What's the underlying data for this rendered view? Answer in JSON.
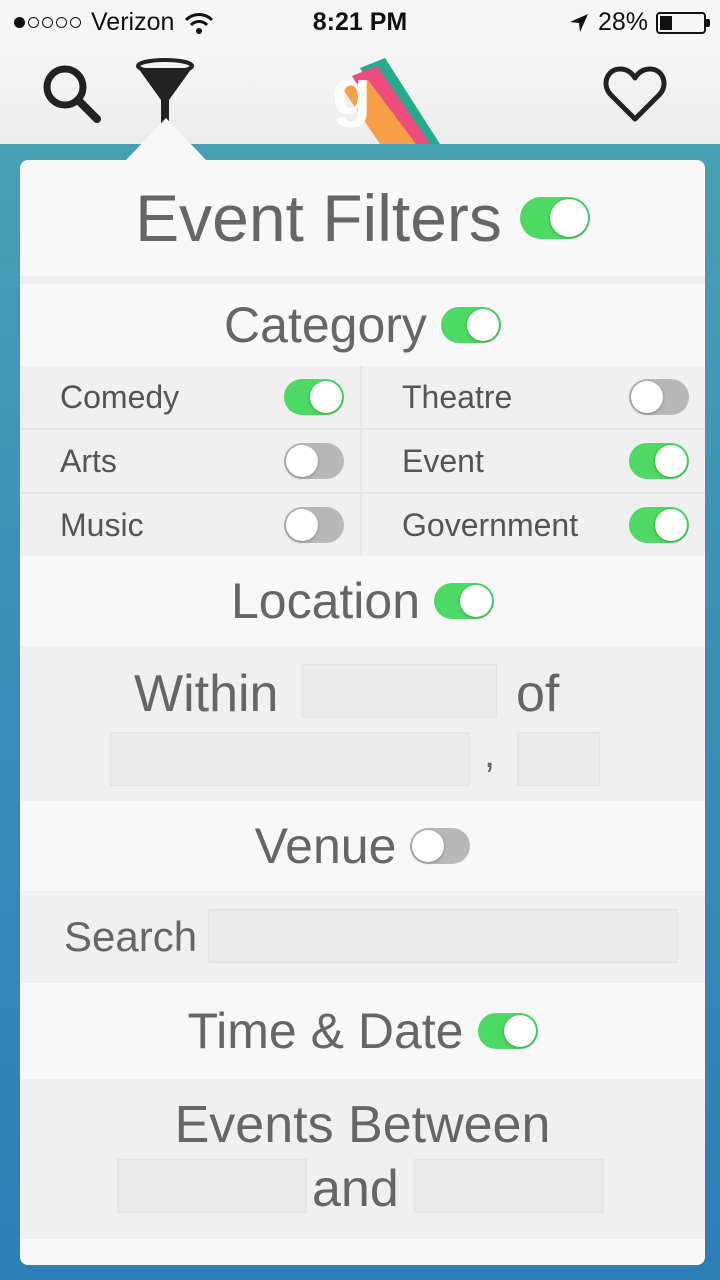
{
  "status": {
    "carrier": "Verizon",
    "time": "8:21 PM",
    "battery": "28%",
    "battery_level": 0.28,
    "signal_bars": 1
  },
  "nav": {
    "icons": [
      "search-icon",
      "filter-icon",
      "app-logo",
      "heart-icon"
    ],
    "logo_letter": "g"
  },
  "filters": {
    "title": "Event Filters",
    "enabled": true,
    "category": {
      "label": "Category",
      "enabled": true,
      "items": [
        {
          "label": "Comedy",
          "on": true
        },
        {
          "label": "Theatre",
          "on": false
        },
        {
          "label": "Arts",
          "on": false
        },
        {
          "label": "Event",
          "on": true
        },
        {
          "label": "Music",
          "on": false
        },
        {
          "label": "Government",
          "on": true
        }
      ]
    },
    "location": {
      "label": "Location",
      "enabled": true,
      "within_label": "Within",
      "of_label": "of",
      "comma": ",",
      "distance_value": "",
      "city_value": "",
      "state_value": ""
    },
    "venue": {
      "label": "Venue",
      "enabled": false,
      "search_label": "Search",
      "search_value": ""
    },
    "time_date": {
      "label": "Time & Date",
      "enabled": true,
      "events_between_label": "Events Between",
      "and_label": "and",
      "start_value": "",
      "end_value": ""
    }
  },
  "colors": {
    "toggle_on": "#4cd964",
    "toggle_off": "#b8b8b8",
    "background": "#3f93b7"
  }
}
